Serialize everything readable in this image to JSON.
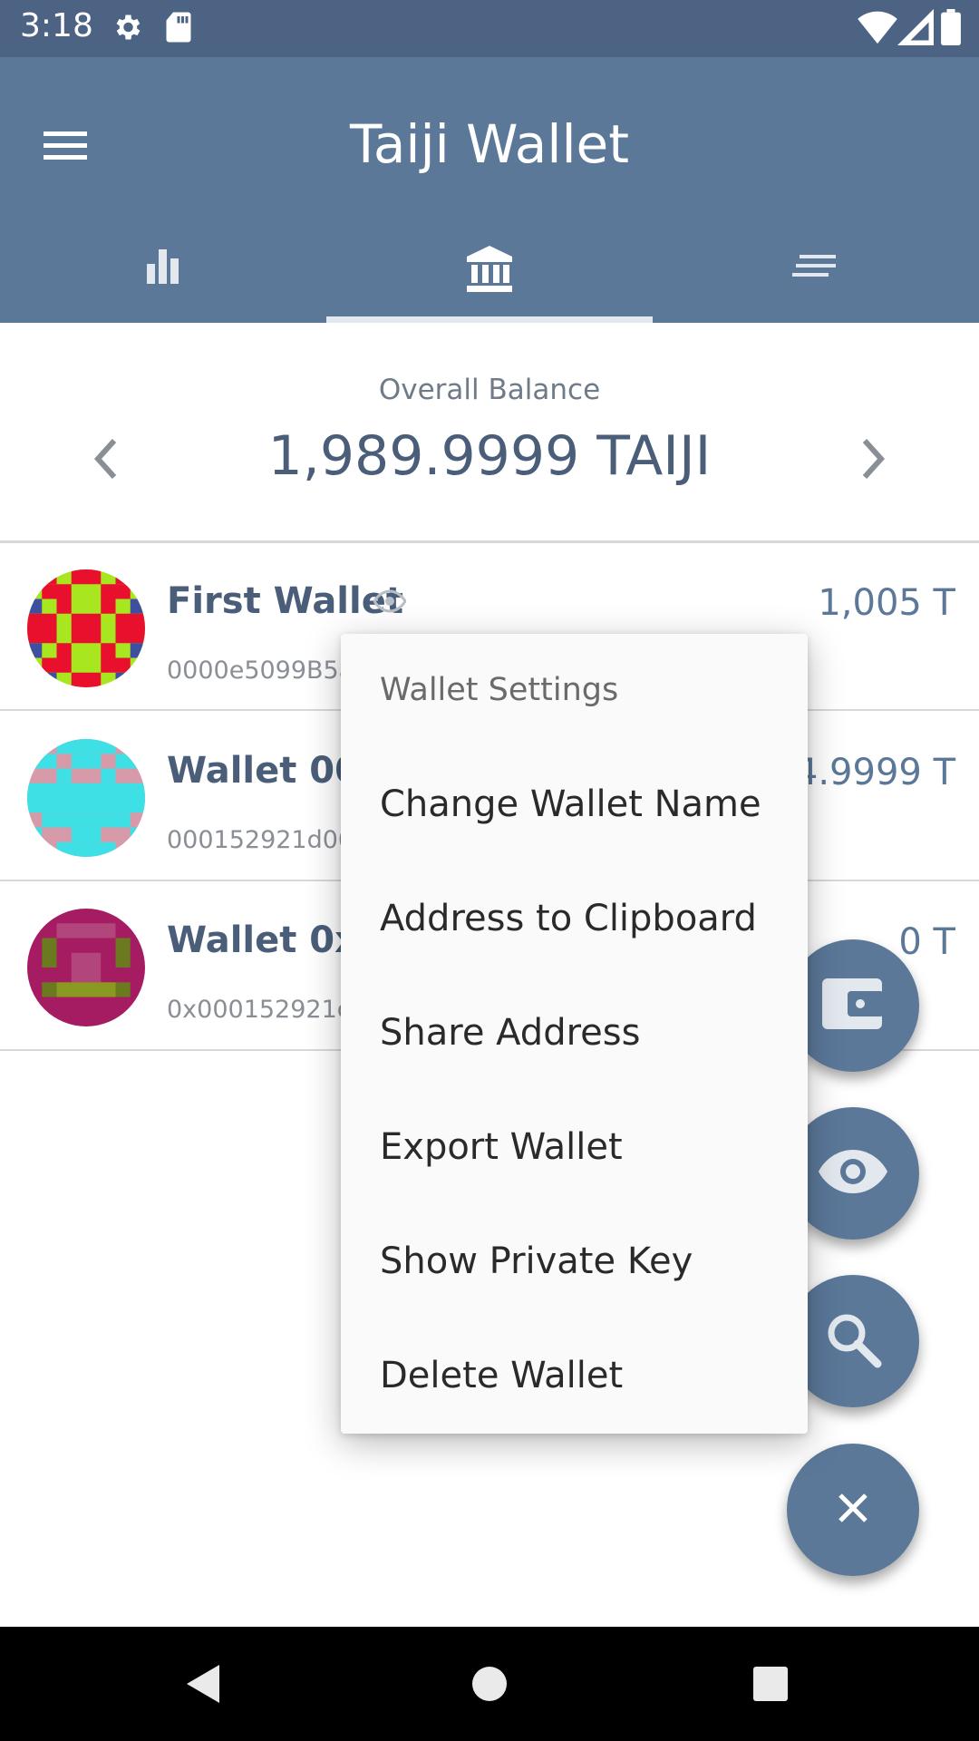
{
  "status_bar": {
    "time": "3:18",
    "icons": [
      "settings-gear-icon",
      "sd-card-icon",
      "wifi-icon",
      "signal-icon",
      "battery-icon"
    ]
  },
  "app_bar": {
    "title": "Taiji Wallet",
    "tabs": [
      {
        "icon": "bar-chart-icon",
        "selected": false
      },
      {
        "icon": "bank-icon",
        "selected": true
      },
      {
        "icon": "list-lines-icon",
        "selected": false
      }
    ]
  },
  "balance": {
    "label": "Overall Balance",
    "value": "1,989.9999 TAIJI"
  },
  "wallets": [
    {
      "name": "First Wallet",
      "address": "0000e5099B5a",
      "amount": "1,005 T",
      "visible_icon": "eye-icon"
    },
    {
      "name": "Wallet 000",
      "address": "000152921d00",
      "amount": "34.9999 T"
    },
    {
      "name": "Wallet 0x0",
      "address": "0x000152921d",
      "amount": "0 T"
    }
  ],
  "context_menu": {
    "header": "Wallet Settings",
    "items": [
      "Change Wallet Name",
      "Address to Clipboard",
      "Share Address",
      "Export Wallet",
      "Show Private Key",
      "Delete Wallet"
    ]
  },
  "fabs": [
    "wallet-icon",
    "eye-icon",
    "search-icon",
    "close-icon"
  ],
  "colors": {
    "primary": "#5b7899",
    "status_bar": "#4c6384",
    "balance_text": "#4a5e7a"
  }
}
